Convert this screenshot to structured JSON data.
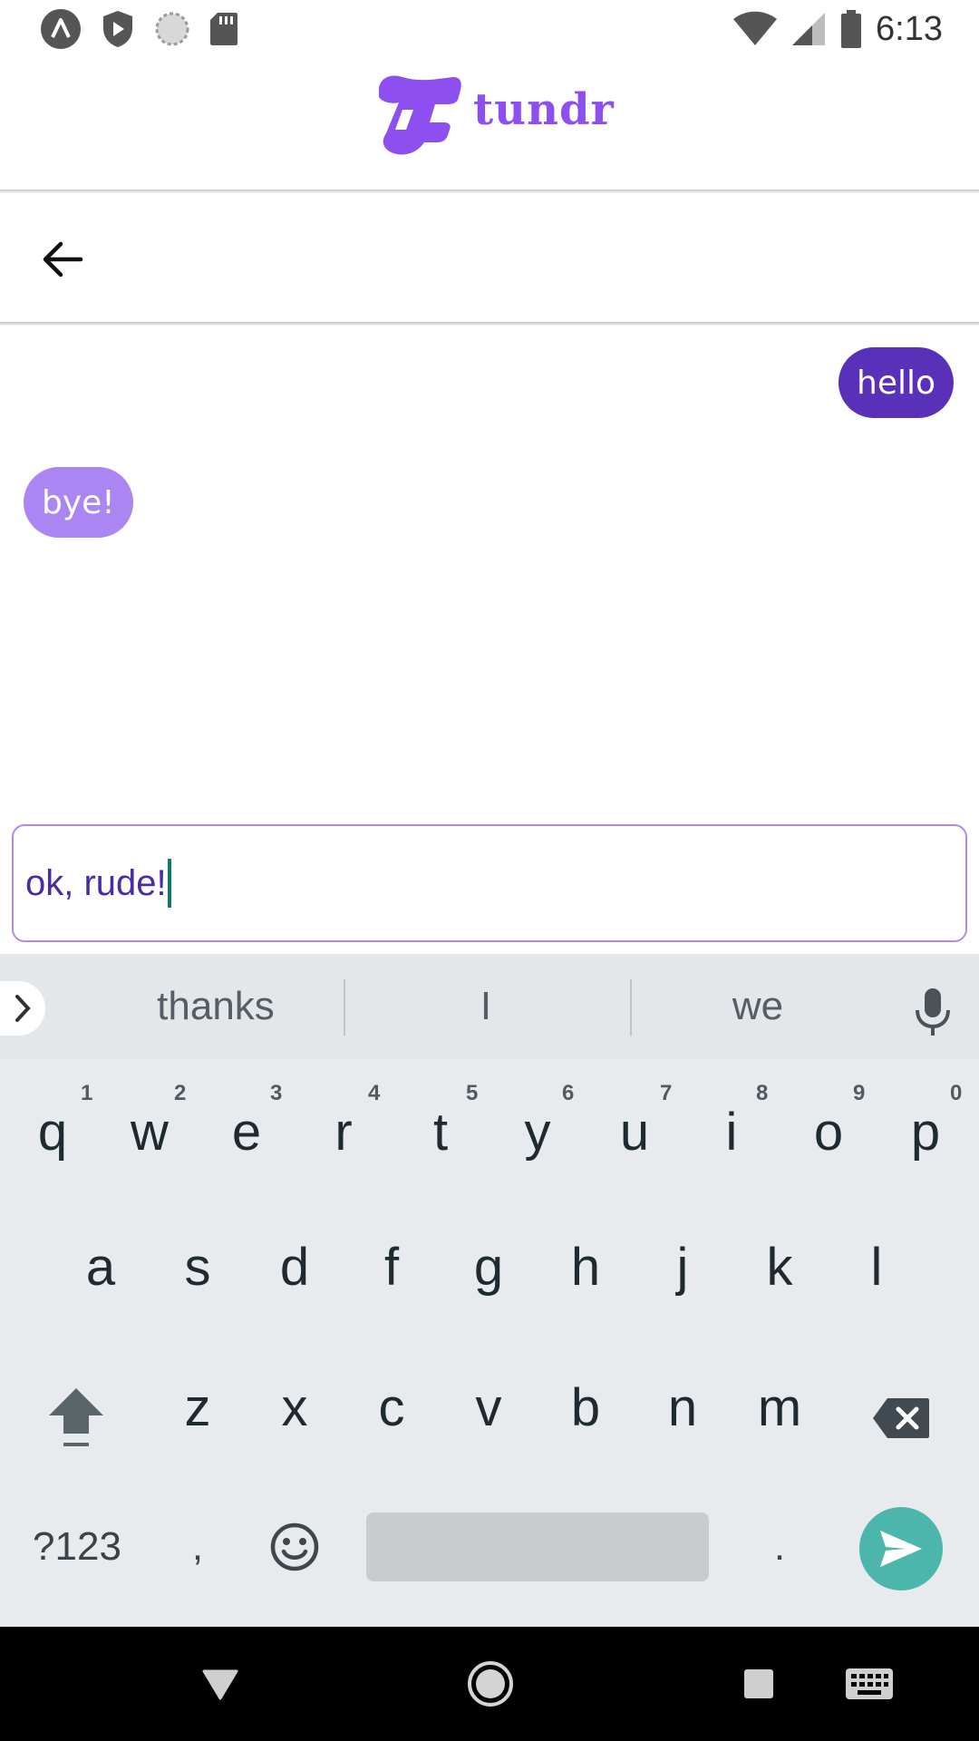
{
  "status_bar": {
    "time": "6:13",
    "icons": [
      "a-app-icon",
      "shield-icon",
      "sync-circle-icon",
      "sd-card-icon",
      "wifi-icon",
      "cell-signal-icon",
      "battery-icon"
    ]
  },
  "header": {
    "logo_text": "tundr",
    "brand_color": "#8e4ff0"
  },
  "toolbar": {
    "back_icon": "arrow-back-icon"
  },
  "messages": [
    {
      "direction": "outgoing",
      "text": "hello",
      "color": "#5930b8"
    },
    {
      "direction": "incoming",
      "text": "bye!",
      "color": "#ab85f2"
    }
  ],
  "input": {
    "value": "ok, rude!"
  },
  "keyboard": {
    "suggestions": [
      "thanks",
      "I",
      "we"
    ],
    "row1": [
      "q",
      "w",
      "e",
      "r",
      "t",
      "y",
      "u",
      "i",
      "o",
      "p"
    ],
    "row1_hints": [
      "1",
      "2",
      "3",
      "4",
      "5",
      "6",
      "7",
      "8",
      "9",
      "0"
    ],
    "row2": [
      "a",
      "s",
      "d",
      "f",
      "g",
      "h",
      "j",
      "k",
      "l"
    ],
    "row3": [
      "z",
      "x",
      "c",
      "v",
      "b",
      "n",
      "m"
    ],
    "symbols_label": "?123",
    "comma": ",",
    "period": ".",
    "enter_color": "#4db6ac"
  }
}
